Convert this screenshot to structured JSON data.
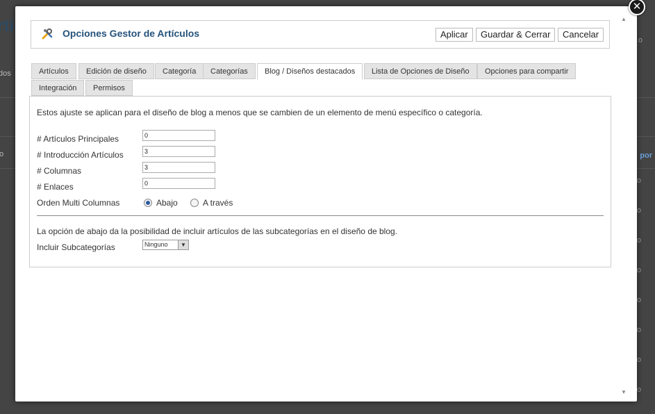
{
  "background": {
    "page_title": "rtic",
    "side_text": "dos",
    "sort_text": "por",
    "col_marker": "o"
  },
  "modal": {
    "close_symbol": "✕",
    "header": {
      "title": "Opciones Gestor de Artículos",
      "apply_label": "Aplicar",
      "save_close_label": "Guardar & Cerrar",
      "cancel_label": "Cancelar"
    },
    "tabs": [
      {
        "label": "Artículos"
      },
      {
        "label": "Edición de diseño"
      },
      {
        "label": "Categoría"
      },
      {
        "label": "Categorías"
      },
      {
        "label": "Blog / Diseños destacados",
        "active": true
      },
      {
        "label": "Lista de Opciones de Diseño"
      },
      {
        "label": "Opciones para compartir"
      },
      {
        "label": "Integración"
      },
      {
        "label": "Permisos"
      }
    ],
    "panel": {
      "intro": "Estos ajuste se aplican para el diseño de blog a menos que se cambien de un elemento de menú específico o categoría.",
      "fields": [
        {
          "label": "# Artículos Principales",
          "value": "0"
        },
        {
          "label": "# Introducción Artículos",
          "value": "3"
        },
        {
          "label": "# Columnas",
          "value": "3"
        },
        {
          "label": "# Enlaces",
          "value": "0"
        }
      ],
      "multi_columns": {
        "label": "Orden Multi Columnas",
        "option_down": "Abajo",
        "option_across": "A través",
        "selected": "Abajo"
      },
      "subcategories_note": "La opción de abajo da la posibilidad de incluir artículos de las subcategorías en el diseño de blog.",
      "include_subcategories": {
        "label": "Incluir Subcategorías",
        "value": "Ninguno"
      }
    }
  }
}
